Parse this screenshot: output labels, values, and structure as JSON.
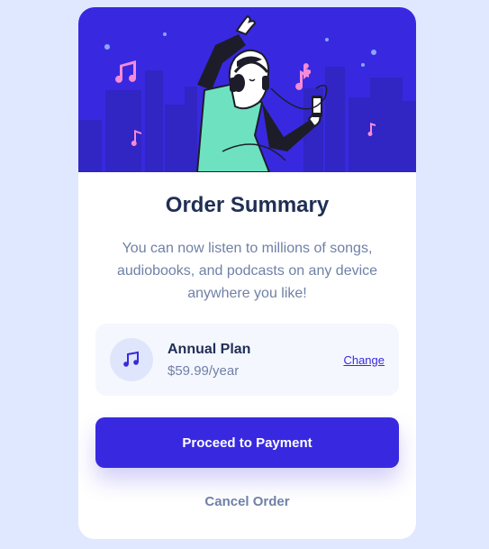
{
  "card": {
    "title": "Order Summary",
    "description": "You can now listen to millions of songs, audiobooks, and podcasts on any device anywhere you like!"
  },
  "plan": {
    "icon": "music-note-icon",
    "name": "Annual Plan",
    "price": "$59.99/year",
    "change_label": "Change"
  },
  "actions": {
    "proceed_label": "Proceed to Payment",
    "cancel_label": "Cancel Order"
  },
  "colors": {
    "page_background": "#e0e8ff",
    "accent": "#3829e0",
    "heading": "#1f2f56",
    "muted_text": "#7080a6",
    "plan_background": "#f5f7ff"
  }
}
